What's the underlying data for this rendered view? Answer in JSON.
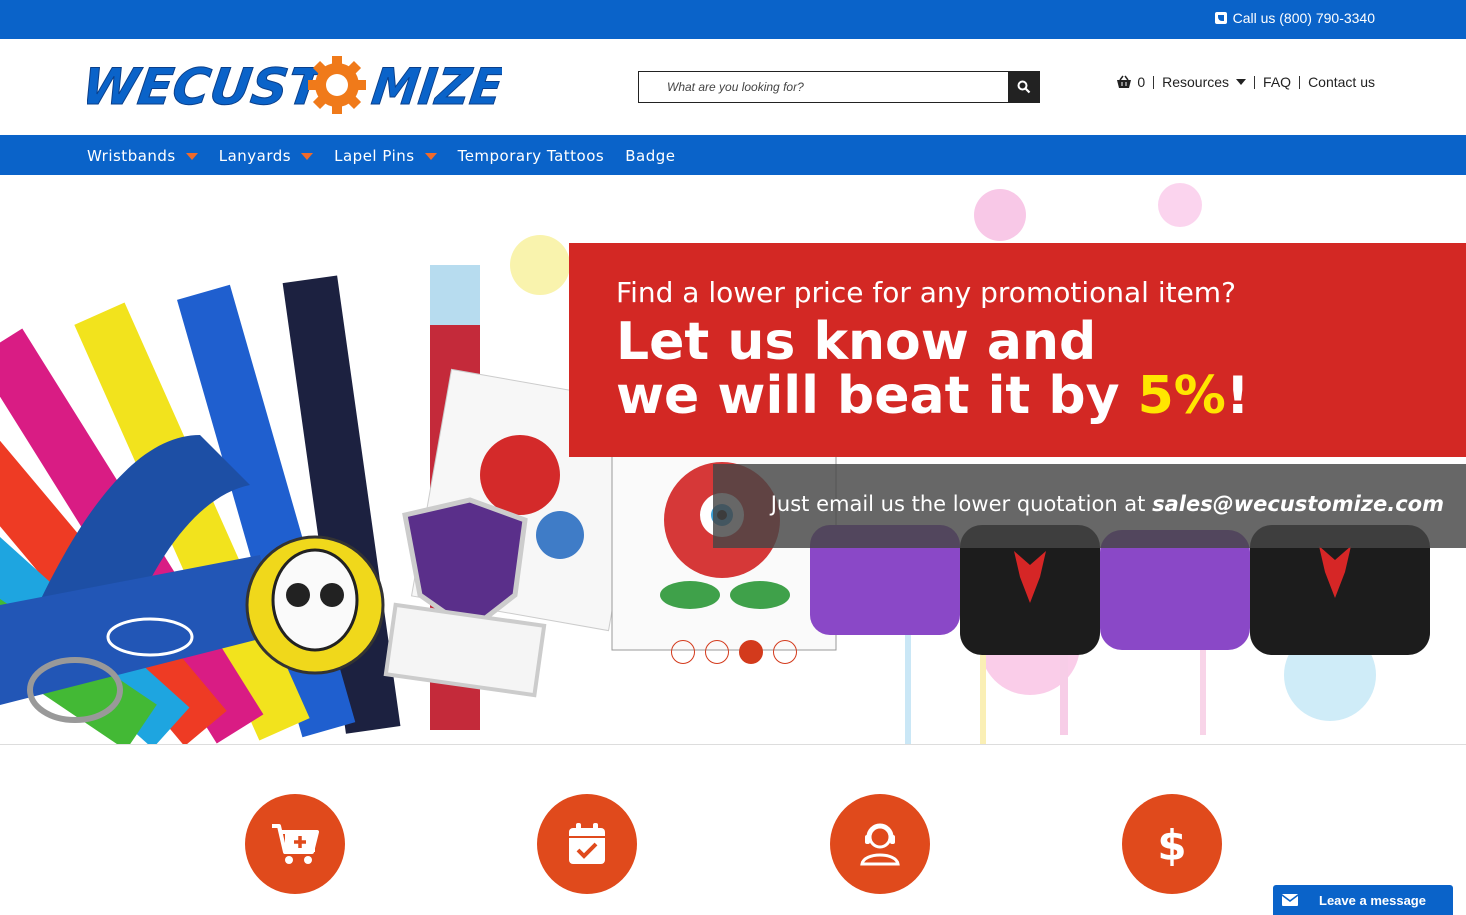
{
  "topbar": {
    "call_text": "Call us (800) 790-3340"
  },
  "header": {
    "logo_text": "WECUSTOMIZE",
    "search": {
      "placeholder": "What are you looking for?"
    },
    "cart_count": "0",
    "links": {
      "resources": "Resources",
      "faq": "FAQ",
      "contact": "Contact us"
    }
  },
  "nav": {
    "items": [
      {
        "label": "Wristbands",
        "dropdown": true
      },
      {
        "label": "Lanyards",
        "dropdown": true
      },
      {
        "label": "Lapel Pins",
        "dropdown": true
      },
      {
        "label": "Temporary Tattoos",
        "dropdown": false
      },
      {
        "label": "Badge",
        "dropdown": false
      }
    ]
  },
  "hero": {
    "promo_line1": "Find a lower price for any promotional item?",
    "promo_line2a": "Let us know and",
    "promo_line2b": "we will beat it by ",
    "promo_pct": "5%",
    "promo_bang": "!",
    "email_prefix": "Just email us the lower quotation at ",
    "email": "sales@wecustomize.com",
    "slider_dots": 4,
    "active_dot": 3
  },
  "features": [
    {
      "icon": "cart-plus-icon"
    },
    {
      "icon": "calendar-check-icon"
    },
    {
      "icon": "support-agent-icon"
    },
    {
      "icon": "dollar-icon"
    }
  ],
  "chat": {
    "label": "Leave a message"
  },
  "colors": {
    "brand_blue": "#0a63c9",
    "accent_orange": "#e04a1c",
    "promo_red": "#d32824",
    "highlight_yellow": "#ffe600"
  }
}
